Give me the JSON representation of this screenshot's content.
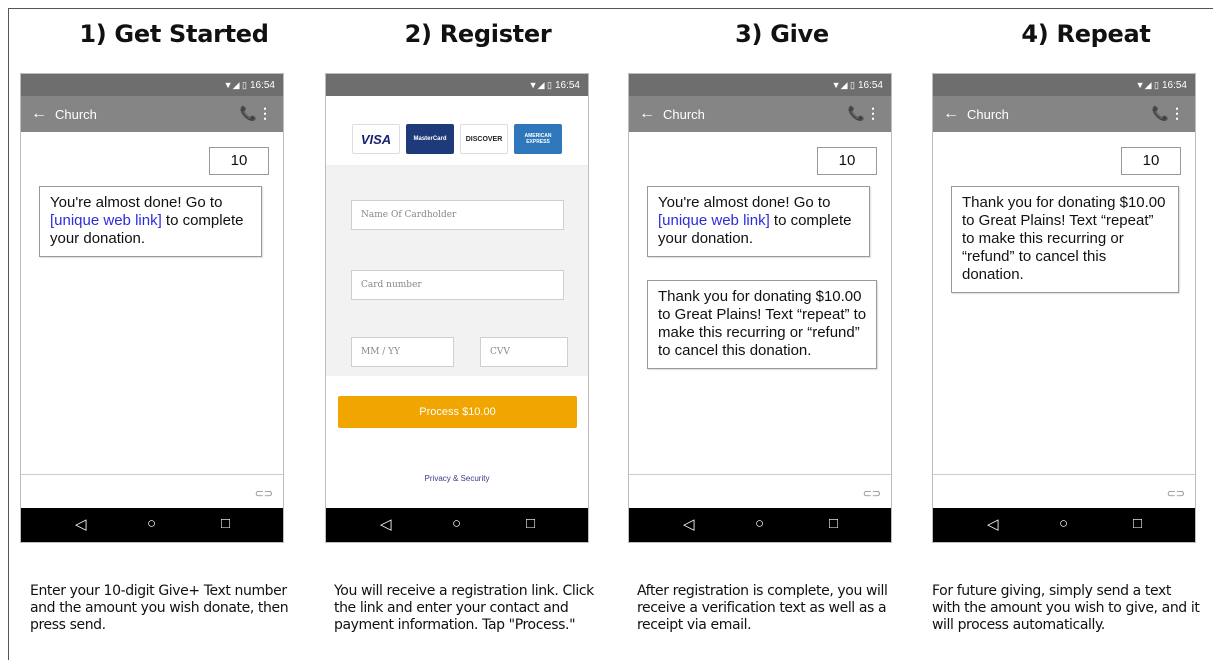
{
  "steps": [
    {
      "title": "1) Get Started",
      "caption": "Enter your 10-digit Give+ Text number and the amount you wish donate, then press send."
    },
    {
      "title": "2) Register",
      "caption": "You will receive a registration link. Click the link and enter your contact and payment information. Tap \"Process.\""
    },
    {
      "title": "3) Give",
      "caption": "After registration is complete, you will receive a verification text as well as a receipt via email."
    },
    {
      "title": "4) Repeat",
      "caption": "For future giving, simply send a text with the amount you wish to give, and it will process automatically."
    }
  ],
  "status_time": "16:54",
  "status_icons": "▼◢ ▯",
  "appbar": {
    "back_icon": "←",
    "title": "Church",
    "phone_icon": "📞",
    "more_icon": "⋮"
  },
  "messages": {
    "sent_amount": "10",
    "link_part1": "You're almost done! Go to ",
    "link_text": "[unique web link]",
    "link_part2": " to complete your donation.",
    "thanks": "Thank you for donating $10.00 to Great Plains! Text “repeat” to make this recurring or “refund” to cancel this donation."
  },
  "register": {
    "cards": [
      "VISA",
      "MasterCard",
      "DISCOVER",
      "AMERICAN EXPRESS"
    ],
    "name_placeholder": "Name Of Cardholder",
    "card_placeholder": "Card number",
    "expiry_placeholder": "MM / YY",
    "cvv_placeholder": "CVV",
    "process_label": "Process $10.00",
    "privacy_label": "Privacy & Security"
  },
  "nav": {
    "back": "◁",
    "home": "○",
    "recent": "□"
  },
  "compose_icon": "⊂⊃",
  "colors": {
    "accent": "#f0a500",
    "link": "#2c2cd8",
    "statusbar": "#6e6e6e",
    "appbar": "#858585"
  }
}
